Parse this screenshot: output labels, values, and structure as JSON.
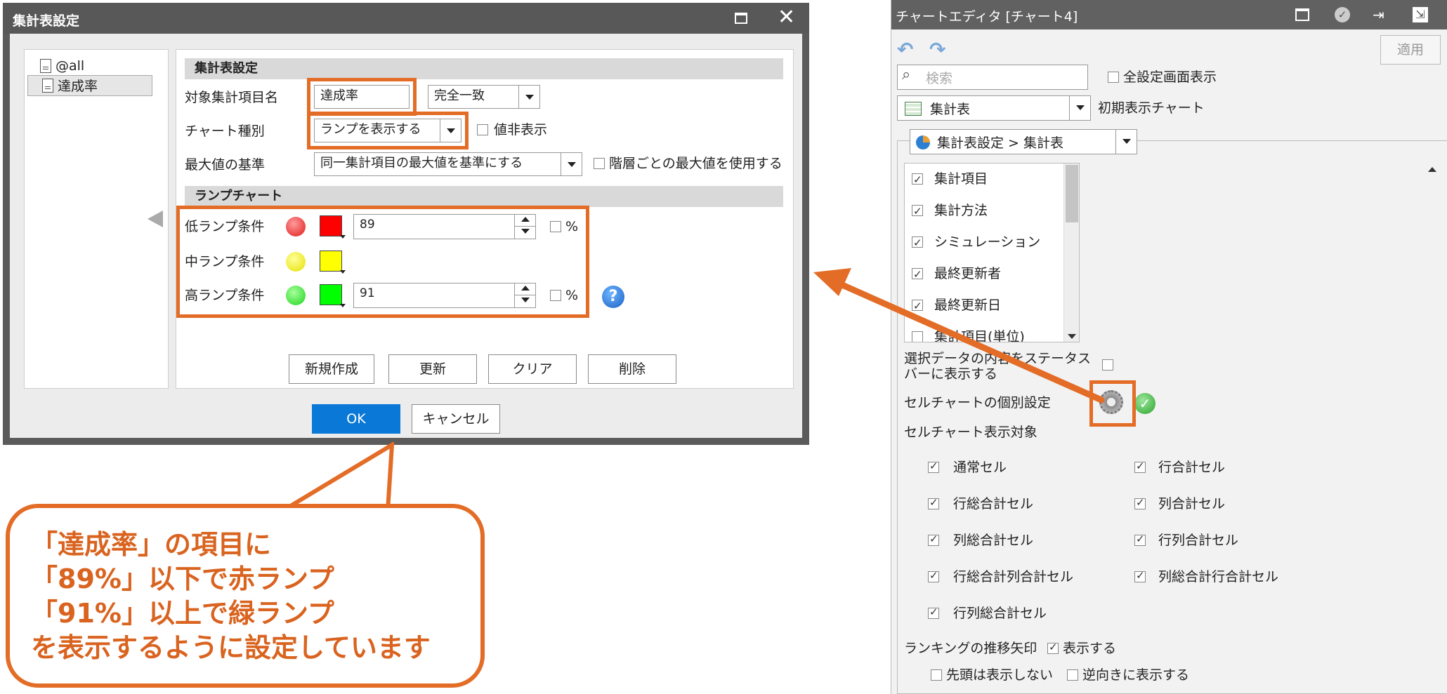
{
  "dialog": {
    "title": "集計表設定",
    "tree_items": [
      "@all",
      "達成率"
    ],
    "section_table": "集計表設定",
    "section_lamp": "ランプチャート",
    "target_label": "対象集計項目名",
    "target_value": "達成率",
    "match_value": "完全一致",
    "chart_type_label": "チャート種別",
    "chart_type_value": "ランプを表示する",
    "hide_value_label": "値非表示",
    "max_basis_label": "最大値の基準",
    "max_basis_value": "同一集計項目の最大値を基準にする",
    "per_level_max_label": "階層ごとの最大値を使用する",
    "low_label": "低ランプ条件",
    "low_value": "89",
    "mid_label": "中ランプ条件",
    "high_label": "高ランプ条件",
    "high_value": "91",
    "percent_label": "%",
    "help_glyph": "?",
    "buttons": {
      "new": "新規作成",
      "update": "更新",
      "clear": "クリア",
      "delete": "削除"
    },
    "ok": "OK",
    "cancel": "キャンセル",
    "close_glyph": "✕",
    "colors": {
      "low": "#ff0000",
      "mid": "#ffff00",
      "high": "#00ff00",
      "accent": "#e36c26"
    }
  },
  "editor": {
    "title": "チャートエディタ [チャート4]",
    "apply": "適用",
    "search_placeholder": "検索",
    "show_all_settings": "全設定画面表示",
    "chart_type": "集計表",
    "initial_chart": "初期表示チャート",
    "setting_path": "集計表設定 > 集計表",
    "list_items": [
      "集計項目",
      "集計方法",
      "シミュレーション",
      "最終更新者",
      "最終更新日",
      "集計項目(単位)"
    ],
    "status_bar_label_1": "選択データの内容をステータス",
    "status_bar_label_2": "バーに表示する",
    "cell_chart_setting": "セルチャートの個別設定",
    "cell_chart_target": "セルチャート表示対象",
    "targets": [
      "通常セル",
      "行合計セル",
      "行総合計セル",
      "列合計セル",
      "列総合計セル",
      "行列合計セル",
      "行総合計列合計セル",
      "列総合計行合計セル",
      "行列総合計セル"
    ],
    "ranking_arrow": "ランキングの推移矢印",
    "show": "表示する",
    "hide_first": "先頭は表示しない",
    "reverse": "逆向きに表示する"
  },
  "callout": {
    "lines": [
      "「達成率」の項目に",
      "「89%」以下で赤ランプ",
      "「91%」以上で緑ランプ",
      "を表示するように設定しています"
    ]
  }
}
